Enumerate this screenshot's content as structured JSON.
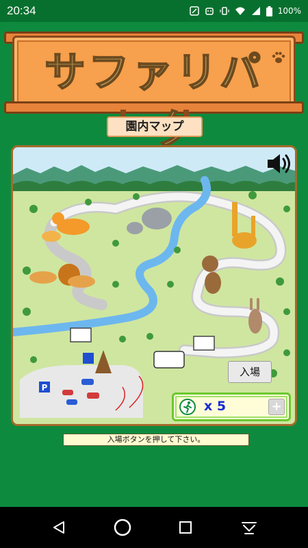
{
  "status_bar": {
    "time": "20:34",
    "battery": "100%",
    "icons": [
      "nfc-icon",
      "sim-robot-icon",
      "vibrate-icon",
      "wifi-icon",
      "signal-icon",
      "battery-icon"
    ]
  },
  "title": {
    "text": "サファリパーク",
    "icon": "paw-print-icon"
  },
  "subtitle": "園内マップ",
  "map": {
    "sound_icon": "speaker-icon",
    "enter_button": "入場",
    "ticket": {
      "icon": "runner-icon",
      "count_text": "x 5",
      "plus_label": "+"
    }
  },
  "instruction": "入場ボタンを押して下さい。",
  "nav": {
    "icons": [
      "back-icon",
      "home-icon",
      "recents-icon",
      "keyboard-hide-icon"
    ]
  },
  "colors": {
    "background": "#0e8a3e",
    "title_plate": "#f7a04d",
    "map_frame": "#a36a2a",
    "ticket_count": "#1a2bd6"
  }
}
